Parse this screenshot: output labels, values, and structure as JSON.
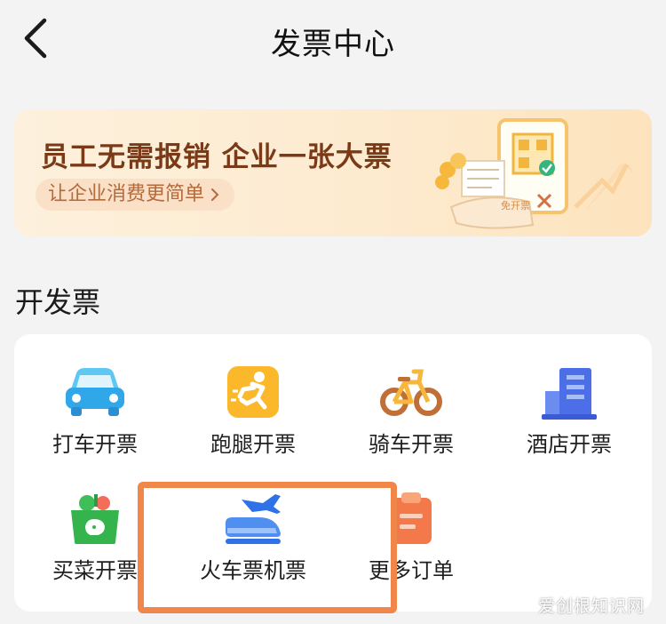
{
  "header": {
    "title": "发票中心",
    "back_icon": "chevron-left-icon"
  },
  "banner": {
    "title": "员工无需报销 企业一张大票",
    "subtitle": "让企业消费更简单",
    "subtitle_icon": "chevron-right-icon",
    "colors": {
      "title": "#7a3a17",
      "pill_bg": "#fae0c7"
    },
    "stamp_text": "免开票"
  },
  "section": {
    "title": "开发票"
  },
  "grid": {
    "items": [
      {
        "label": "打车开票",
        "icon": "taxi-icon"
      },
      {
        "label": "跑腿开票",
        "icon": "runner-icon"
      },
      {
        "label": "骑车开票",
        "icon": "bicycle-icon"
      },
      {
        "label": "酒店开票",
        "icon": "hotel-icon"
      },
      {
        "label": "买菜开票",
        "icon": "grocery-basket-icon"
      },
      {
        "label": "火车票机票",
        "icon": "train-plane-icon"
      },
      {
        "label": "更多订单",
        "icon": "clipboard-icon"
      }
    ]
  },
  "highlight": {
    "color": "#f0864a"
  },
  "watermark": {
    "text": "爱创根知识网"
  }
}
